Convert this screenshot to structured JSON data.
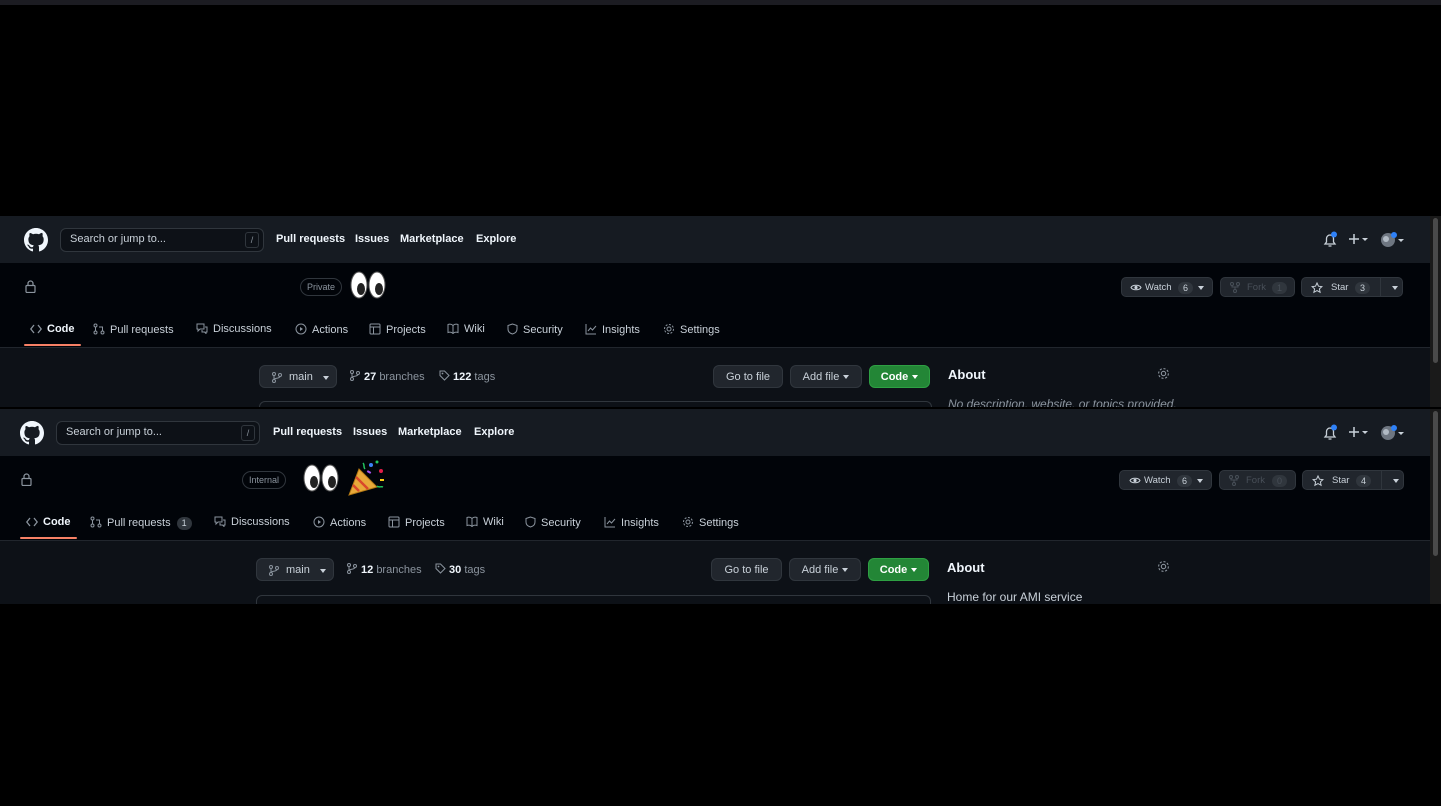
{
  "panels": [
    {
      "header": {
        "search_placeholder": "Search or jump to...",
        "search_shortcut": "/",
        "nav": [
          "Pull requests",
          "Issues",
          "Marketplace",
          "Explore"
        ]
      },
      "repo": {
        "visibility": "Private",
        "emoji": [
          "eyes"
        ],
        "watch": {
          "label": "Watch",
          "count": "6"
        },
        "fork": {
          "label": "Fork",
          "count": "1"
        },
        "star": {
          "label": "Star",
          "count": "3"
        }
      },
      "tabs": [
        {
          "label": "Code",
          "icon": "code-icon",
          "selected": true
        },
        {
          "label": "Pull requests",
          "icon": "git-pull-request-icon"
        },
        {
          "label": "Discussions",
          "icon": "comment-discussion-icon"
        },
        {
          "label": "Actions",
          "icon": "play-icon"
        },
        {
          "label": "Projects",
          "icon": "table-icon"
        },
        {
          "label": "Wiki",
          "icon": "book-icon"
        },
        {
          "label": "Security",
          "icon": "shield-icon"
        },
        {
          "label": "Insights",
          "icon": "graph-icon"
        },
        {
          "label": "Settings",
          "icon": "gear-icon"
        }
      ],
      "code": {
        "branch": "main",
        "branches_count": "27",
        "branches_label": "branches",
        "tags_count": "122",
        "tags_label": "tags",
        "go_to_file": "Go to file",
        "add_file": "Add file",
        "code_button": "Code"
      },
      "about": {
        "title": "About",
        "description": "No description, website, or topics provided."
      }
    },
    {
      "header": {
        "search_placeholder": "Search or jump to...",
        "search_shortcut": "/",
        "nav": [
          "Pull requests",
          "Issues",
          "Marketplace",
          "Explore"
        ]
      },
      "repo": {
        "visibility": "Internal",
        "emoji": [
          "eyes",
          "party-popper"
        ],
        "watch": {
          "label": "Watch",
          "count": "6"
        },
        "fork": {
          "label": "Fork",
          "count": "0"
        },
        "star": {
          "label": "Star",
          "count": "4"
        }
      },
      "tabs": [
        {
          "label": "Code",
          "icon": "code-icon",
          "selected": true
        },
        {
          "label": "Pull requests",
          "icon": "git-pull-request-icon",
          "count": "1"
        },
        {
          "label": "Discussions",
          "icon": "comment-discussion-icon"
        },
        {
          "label": "Actions",
          "icon": "play-icon"
        },
        {
          "label": "Projects",
          "icon": "table-icon"
        },
        {
          "label": "Wiki",
          "icon": "book-icon"
        },
        {
          "label": "Security",
          "icon": "shield-icon"
        },
        {
          "label": "Insights",
          "icon": "graph-icon"
        },
        {
          "label": "Settings",
          "icon": "gear-icon"
        }
      ],
      "code": {
        "branch": "main",
        "branches_count": "12",
        "branches_label": "branches",
        "tags_count": "30",
        "tags_label": "tags",
        "go_to_file": "Go to file",
        "add_file": "Add file",
        "code_button": "Code"
      },
      "about": {
        "title": "About",
        "description": "Home for our AMI service"
      }
    }
  ],
  "colors": {
    "accent_green": "#238636",
    "tab_underline": "#f78166",
    "notification_dot": "#2f81f7"
  }
}
